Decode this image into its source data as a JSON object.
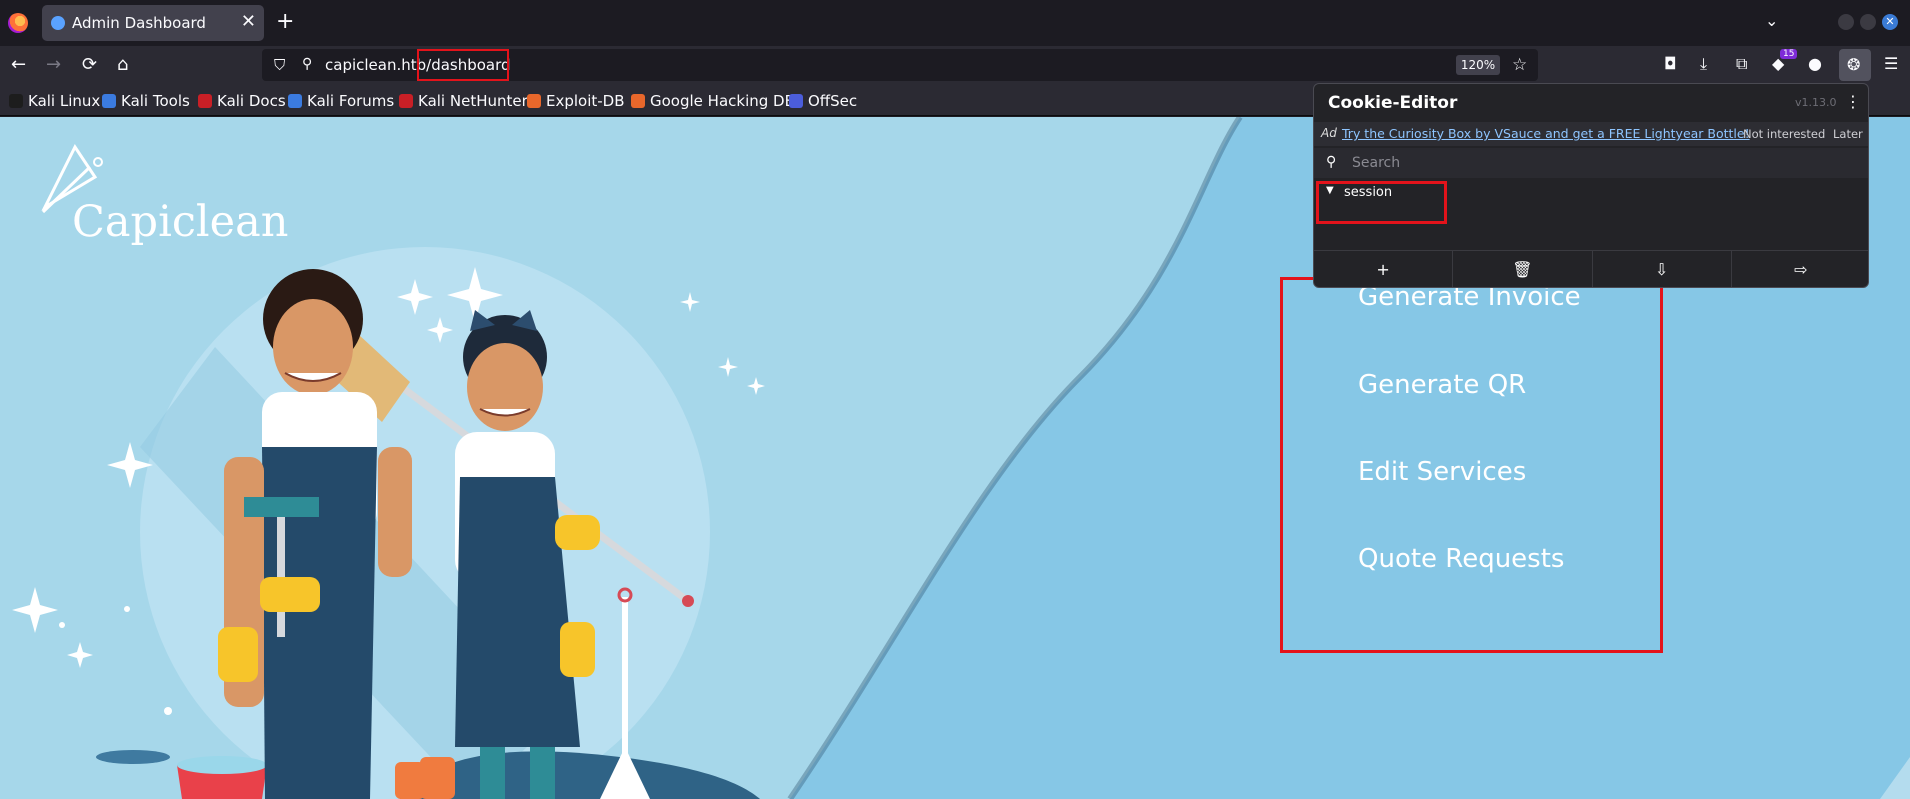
{
  "browser": {
    "tab_title": "Admin Dashboard",
    "tab_close": "✕",
    "new_tab": "+",
    "tab_list": "⌄",
    "url": "capiclean.htb/dashboard",
    "zoom": "120%",
    "extension_badge": "15",
    "window_close": "✕",
    "nav": {
      "back": "←",
      "forward": "→",
      "reload": "⟳",
      "home": "⌂",
      "star": "☆"
    }
  },
  "bookmarks": [
    {
      "label": "Kali Linux",
      "color": "#1d1d1d"
    },
    {
      "label": "Kali Tools",
      "color": "#3b7be0"
    },
    {
      "label": "Kali Docs",
      "color": "#c91f26"
    },
    {
      "label": "Kali Forums",
      "color": "#3b7be0"
    },
    {
      "label": "Kali NetHunter",
      "color": "#c91f26"
    },
    {
      "label": "Exploit-DB",
      "color": "#e8672b"
    },
    {
      "label": "Google Hacking DB",
      "color": "#e8672b"
    },
    {
      "label": "OffSec",
      "color": "#4b5ddb"
    }
  ],
  "page": {
    "logo": "Capiclean",
    "menu": [
      "Generate Invoice",
      "Generate QR",
      "Edit Services",
      "Quote Requests"
    ]
  },
  "cookie_editor": {
    "title": "Cookie-Editor",
    "version": "v1.13.0",
    "ad_label": "Ad",
    "ad_text": "Try the Curiosity Box by VSauce and get a FREE Lightyear Bottle!",
    "not_interested": "Not interested",
    "later": "Later",
    "search_placeholder": "Search",
    "cookies": [
      "session"
    ],
    "footer": {
      "add": "+",
      "delete": "🗑",
      "import": "⇩",
      "export": "⇨"
    }
  },
  "colors": {
    "highlight": "#e3131b",
    "page_bg": "#a6d7ea",
    "wave_bg": "#86c7e6"
  }
}
